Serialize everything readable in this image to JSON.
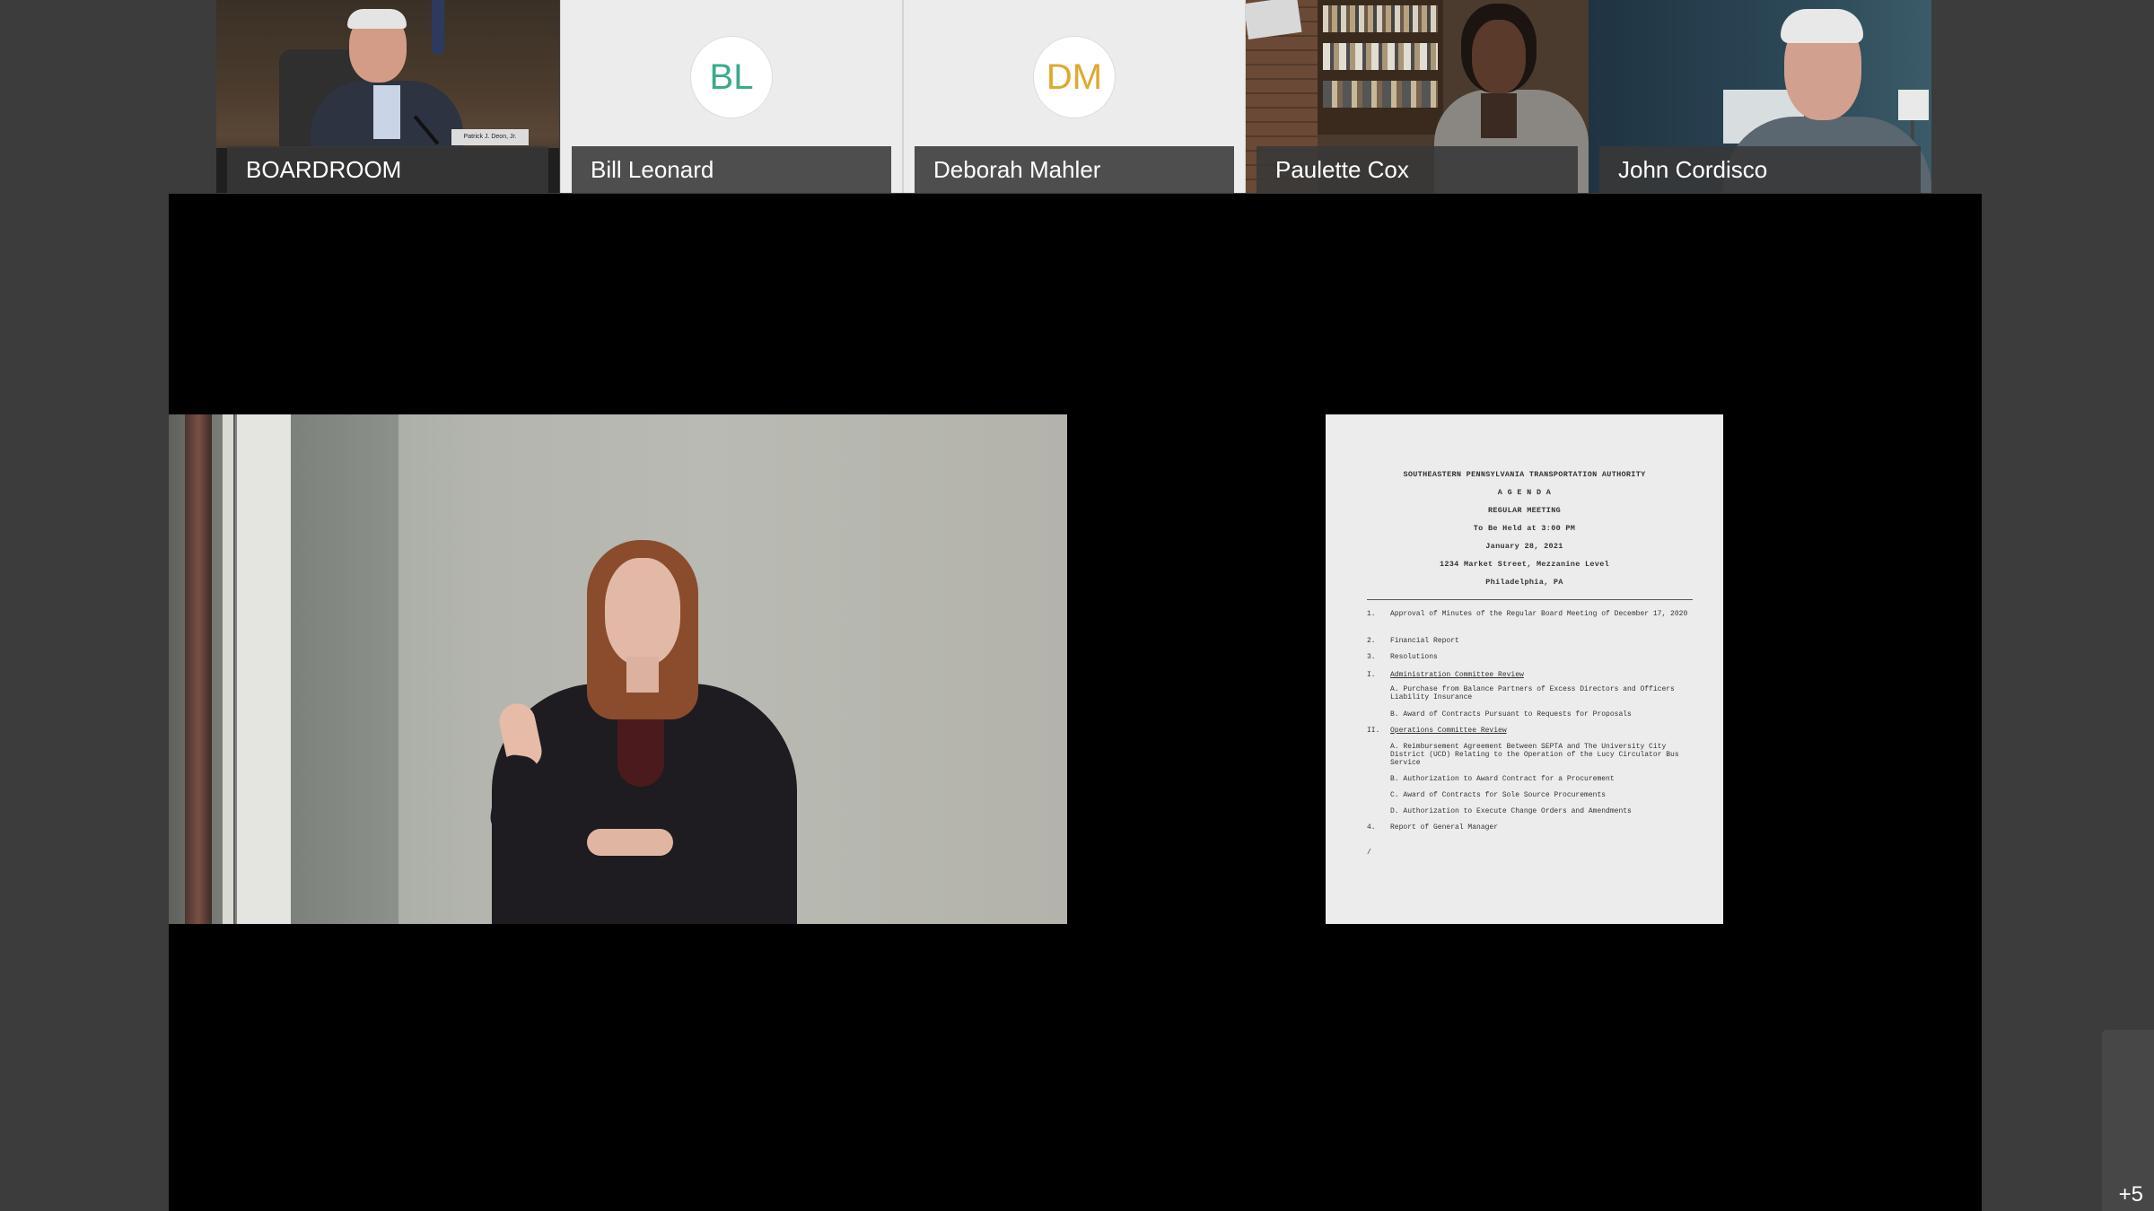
{
  "participants": [
    {
      "name": "BOARDROOM",
      "type": "video"
    },
    {
      "name": "Bill Leonard",
      "type": "avatar",
      "initials": "BL",
      "initials_color": "#3aaa8c"
    },
    {
      "name": "Deborah Mahler",
      "type": "avatar",
      "initials": "DM",
      "initials_color": "#e0a82e"
    },
    {
      "name": "Paulette Cox",
      "type": "video"
    },
    {
      "name": "John Cordisco",
      "type": "video"
    }
  ],
  "boardroom_nameplate": "Patrick J. Deon, Jr.",
  "overflow_badge": "+5",
  "shared_document": {
    "header": [
      "SOUTHEASTERN PENNSYLVANIA TRANSPORTATION AUTHORITY",
      "A G E N D A",
      "REGULAR MEETING",
      "To Be Held at 3:00 PM",
      "January 28, 2021",
      "1234 Market Street, Mezzanine Level",
      "Philadelphia, PA"
    ],
    "items": [
      {
        "num": "1.",
        "text": "Approval of Minutes of the Regular Board Meeting of December 17, 2020"
      },
      {
        "num": "2.",
        "text": "Financial Report"
      },
      {
        "num": "3.",
        "text": "Resolutions"
      },
      {
        "num": "I.",
        "text": "Administration Committee Review",
        "underline": true
      },
      {
        "num": "",
        "text": "A.   Purchase from Balance Partners of Excess Directors and Officers Liability Insurance",
        "indent": true
      },
      {
        "num": "",
        "text": "B.   Award of Contracts Pursuant to Requests for Proposals",
        "indent": true
      },
      {
        "num": "II.",
        "text": "Operations Committee Review",
        "underline": true
      },
      {
        "num": "",
        "text": "A.   Reimbursement Agreement Between SEPTA and The University City District (UCD) Relating to the Operation of the Lucy Circulator Bus Service",
        "indent": true
      },
      {
        "num": "",
        "text": "B.   Authorization to Award Contract for a Procurement",
        "indent": true
      },
      {
        "num": "",
        "text": "C.   Award of Contracts for Sole Source Procurements",
        "indent": true
      },
      {
        "num": "",
        "text": "D.   Authorization to Execute Change Orders and Amendments",
        "indent": true
      },
      {
        "num": "4.",
        "text": "Report of General Manager"
      },
      {
        "num": "",
        "text": "/"
      }
    ]
  }
}
